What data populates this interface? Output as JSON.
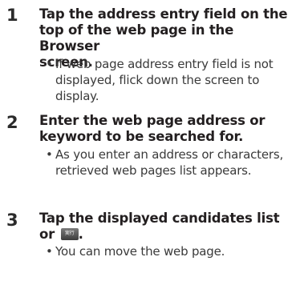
{
  "steps": [
    {
      "number": "1",
      "heading_lines": [
        "Tap the address entry field on the",
        "top of the web page in the Browser",
        "screen."
      ],
      "note_bullet": "•",
      "note_lines": [
        "If web page address entry field is not",
        "displayed, flick down the screen to",
        "display."
      ]
    },
    {
      "number": "2",
      "heading_lines": [
        "Enter the web page address or",
        "keyword to be searched for."
      ],
      "note_bullet": "•",
      "note_lines": [
        "As you enter an address or characters,",
        "retrieved web pages list appears."
      ]
    },
    {
      "number": "3",
      "heading_lines": [
        "Tap the displayed candidates list",
        "or"
      ],
      "heading_suffix": ".",
      "key_icon": {
        "name": "execute-key-icon",
        "label": "実行"
      },
      "note_bullet": "•",
      "note_lines": [
        "You can move the web page."
      ]
    }
  ]
}
